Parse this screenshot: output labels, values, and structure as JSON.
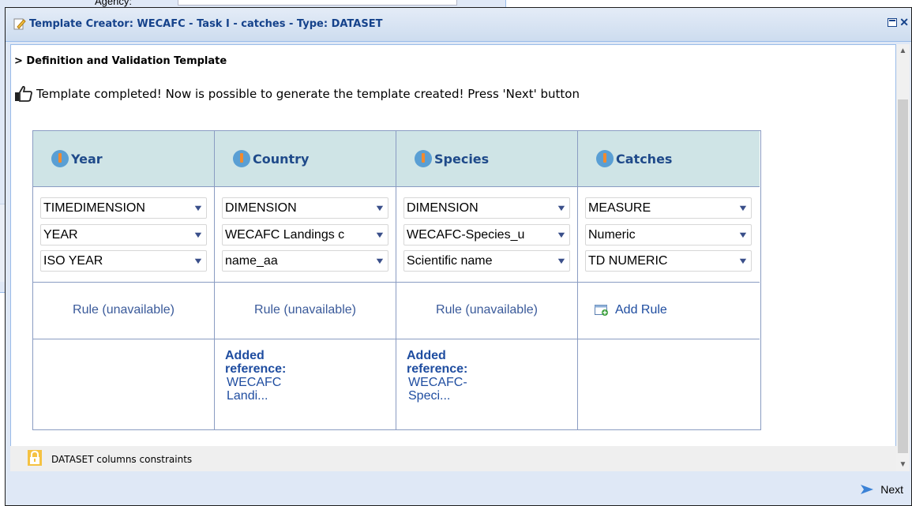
{
  "background": {
    "field_label": "Agency:"
  },
  "window": {
    "title": "Template Creator: WECAFC - Task I - catches - Type: DATASET"
  },
  "section_title": "> Definition and Validation Template",
  "status_message": "Template completed! Now is possible to generate the template created! Press 'Next' button",
  "columns": [
    {
      "name": "Year",
      "selects": [
        "TIMEDIMENSION",
        "YEAR",
        "ISO YEAR"
      ],
      "rule": "Rule (unavailable)",
      "reference_label": "",
      "reference_value": ""
    },
    {
      "name": "Country",
      "selects": [
        "DIMENSION",
        "WECAFC Landings c",
        "name_aa"
      ],
      "rule": "Rule (unavailable)",
      "reference_label": "Added reference:",
      "reference_value": "WECAFC Landi..."
    },
    {
      "name": "Species",
      "selects": [
        "DIMENSION",
        "WECAFC-Species_u",
        "Scientific name"
      ],
      "rule": "Rule (unavailable)",
      "reference_label": "Added reference:",
      "reference_value": "WECAFC-Speci..."
    },
    {
      "name": "Catches",
      "selects": [
        "MEASURE",
        "Numeric",
        "TD NUMERIC"
      ],
      "rule": "Add Rule",
      "reference_label": "",
      "reference_value": ""
    }
  ],
  "constraints_label": "DATASET columns constraints",
  "footer": {
    "next_label": "Next"
  },
  "colors": {
    "title_text": "#15428b",
    "header_bg": "#cfe4e6",
    "link": "#1f4da0"
  }
}
